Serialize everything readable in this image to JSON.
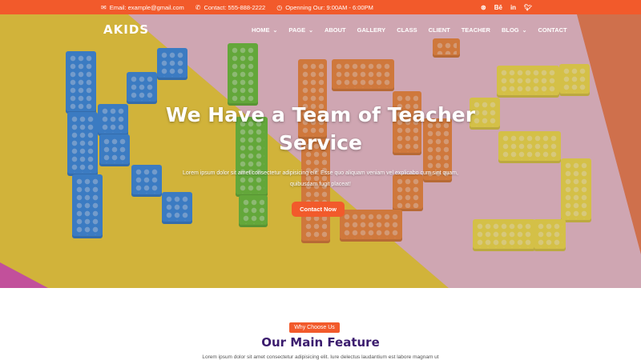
{
  "topbar": {
    "email": "Email: example@gmail.com",
    "contact": "Contact: 555-888-2222",
    "opening": "Openning Our: 9:00AM - 6:00PM",
    "icons": [
      "envelope-icon",
      "phone-icon",
      "clock-icon"
    ],
    "social": [
      "dribbble-icon",
      "behance-icon",
      "linkedin-icon",
      "twitter-icon"
    ],
    "social_labels": {
      "behance": "Bē",
      "linkedin": "in"
    }
  },
  "header": {
    "logo": "AKIDS",
    "nav": [
      {
        "label": "HOME",
        "dropdown": true
      },
      {
        "label": "PAGE",
        "dropdown": true
      },
      {
        "label": "ABOUT",
        "dropdown": false
      },
      {
        "label": "GALLERY",
        "dropdown": false
      },
      {
        "label": "CLASS",
        "dropdown": false
      },
      {
        "label": "CLIENT",
        "dropdown": false
      },
      {
        "label": "TEACHER",
        "dropdown": false
      },
      {
        "label": "BLOG",
        "dropdown": true
      },
      {
        "label": "CONTACT",
        "dropdown": false
      }
    ]
  },
  "hero": {
    "title_line1": "We Have a Team of Teacher",
    "title_line2": "Service",
    "text": "Lorem ipsum dolor sit amet consectetur adipisicing elit. Esse quo aliquam veniam vel explicabo cum sint quam, quibusdam fugit placeat!",
    "button": "Contact Now"
  },
  "features": {
    "badge": "Why Choose Us",
    "title": "Our Main Feature",
    "text": "Lorem ipsum dolor sit amet consectetur adipisicing elit. Iure delectus laudantium est labore magnam ut"
  },
  "colors": {
    "accent": "#f25a2b",
    "title": "#3b1c6e"
  }
}
